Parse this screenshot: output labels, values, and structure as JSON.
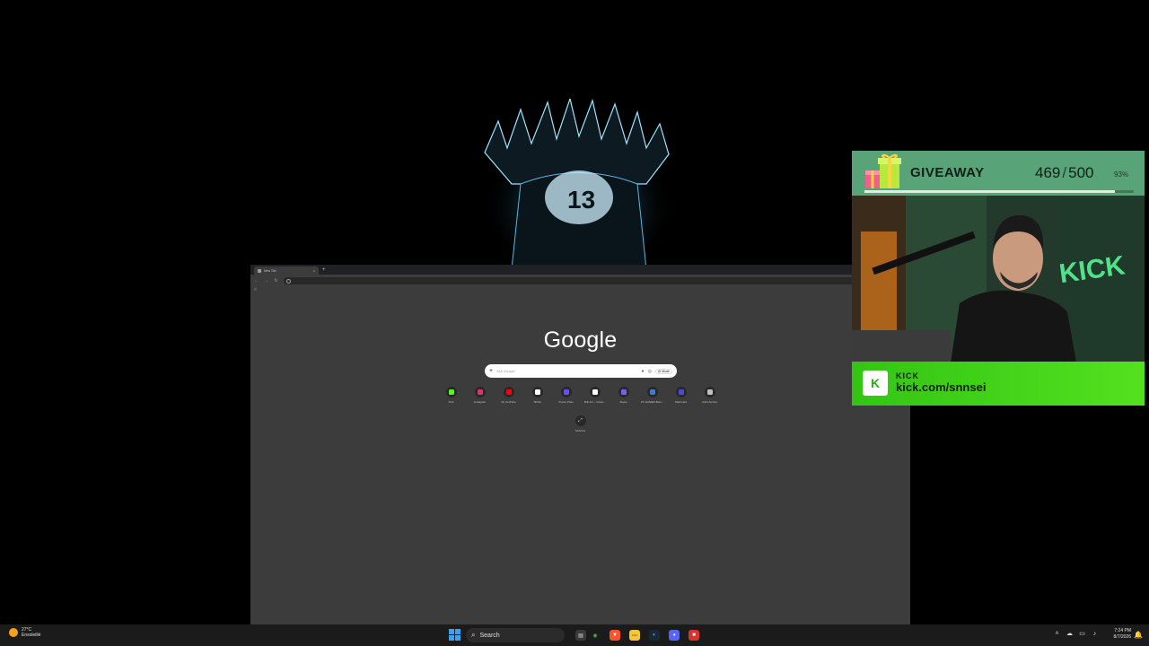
{
  "browser": {
    "tab_title": "New Tab",
    "tab_close": "×",
    "new_tab": "+",
    "nav": {
      "back": "←",
      "forward": "→",
      "reload": "↻"
    },
    "bookmarks_icon": "apps-icon",
    "google_logo": "Google",
    "search": {
      "placeholder": "Ask Google",
      "mode_label": "AI Mode",
      "plus": "+"
    },
    "shortcuts": [
      {
        "label": "Kick",
        "color": "#53fc18"
      },
      {
        "label": "Instagram",
        "color": "#e1306c"
      },
      {
        "label": "(9) YouTube",
        "color": "#ff0000"
      },
      {
        "label": "TikTok",
        "color": "#ffffff"
      },
      {
        "label": "Proton Pass",
        "color": "#6d4aff"
      },
      {
        "label": "Bolt.fun – Creat...",
        "color": "#ffffff"
      },
      {
        "label": "Skype",
        "color": "#7c5cff"
      },
      {
        "label": "PC GAMER Belo...",
        "color": "#3a7bd5"
      },
      {
        "label": "Starboard",
        "color": "#4a4ae0"
      },
      {
        "label": "Add shortcut",
        "color": "#bdc1c6"
      }
    ],
    "shortcut_extra": {
      "label": "Shortcut",
      "icon": "⤢"
    }
  },
  "giveaway": {
    "title": "GIVEAWAY",
    "current": "469",
    "separator": "/",
    "total": "500",
    "percent": "93%",
    "progress": 0.93
  },
  "kick": {
    "logo_letter": "K",
    "brand": "KICK",
    "url": "kick.com/snnsei"
  },
  "taskbar": {
    "weather_temp": "27°C",
    "weather_cond": "Ensoleillé",
    "search_label": "Search",
    "search_icon": "⌕",
    "apps": [
      {
        "name": "files-icon",
        "glyph": "▤",
        "bg": "#3a3a3a",
        "fg": "#dcdcdc"
      },
      {
        "name": "chrome-icon",
        "glyph": "◉",
        "bg": "#1b1b1b",
        "fg": "#4caf50"
      },
      {
        "name": "brave-icon",
        "glyph": "▼",
        "bg": "#fb542b",
        "fg": "#ffffff"
      },
      {
        "name": "folder-icon",
        "glyph": "▬",
        "bg": "#f3c63d",
        "fg": "#c99a1a"
      },
      {
        "name": "steam-icon",
        "glyph": "◐",
        "bg": "#1b2838",
        "fg": "#66c0f4"
      },
      {
        "name": "discord-icon",
        "glyph": "◕",
        "bg": "#5865f2",
        "fg": "#ffffff"
      },
      {
        "name": "media-app-icon",
        "glyph": "■",
        "bg": "#d6342c",
        "fg": "#ffffff"
      }
    ],
    "tray": [
      "˄",
      "☁",
      "▭",
      "♪"
    ],
    "time": "7:24 PM",
    "date": "8/7/2026",
    "notif": "🔔"
  }
}
